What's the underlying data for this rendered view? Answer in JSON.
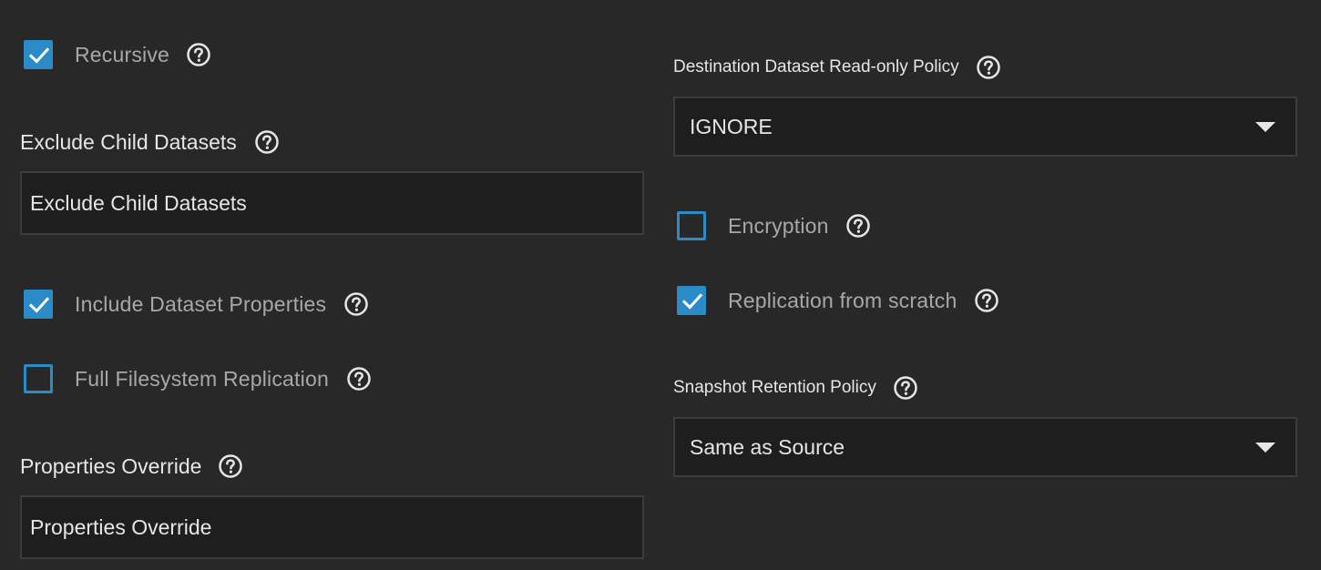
{
  "left": {
    "recursive": {
      "label": "Recursive",
      "checked": true
    },
    "exclude_child": {
      "label": "Exclude Child Datasets",
      "placeholder": "Exclude Child Datasets"
    },
    "include_props": {
      "label": "Include Dataset Properties",
      "checked": true
    },
    "full_fs": {
      "label": "Full Filesystem Replication",
      "checked": false
    },
    "props_override": {
      "label": "Properties Override",
      "placeholder": "Properties Override"
    }
  },
  "right": {
    "readonly_policy": {
      "label": "Destination Dataset Read-only Policy",
      "value": "IGNORE"
    },
    "encryption": {
      "label": "Encryption",
      "checked": false
    },
    "from_scratch": {
      "label": "Replication from scratch",
      "checked": true
    },
    "retention_policy": {
      "label": "Snapshot Retention Policy",
      "value": "Same as Source"
    }
  },
  "icons": {
    "help": "help-circle-icon",
    "check": "checkmark-icon",
    "dropdown": "caret-down-icon"
  },
  "colors": {
    "background": "#282828",
    "field_bg": "#1e1e1e",
    "accent": "#2b8bc6",
    "label": "#e6e6e6",
    "checkbox_label": "#a8a8a8"
  }
}
